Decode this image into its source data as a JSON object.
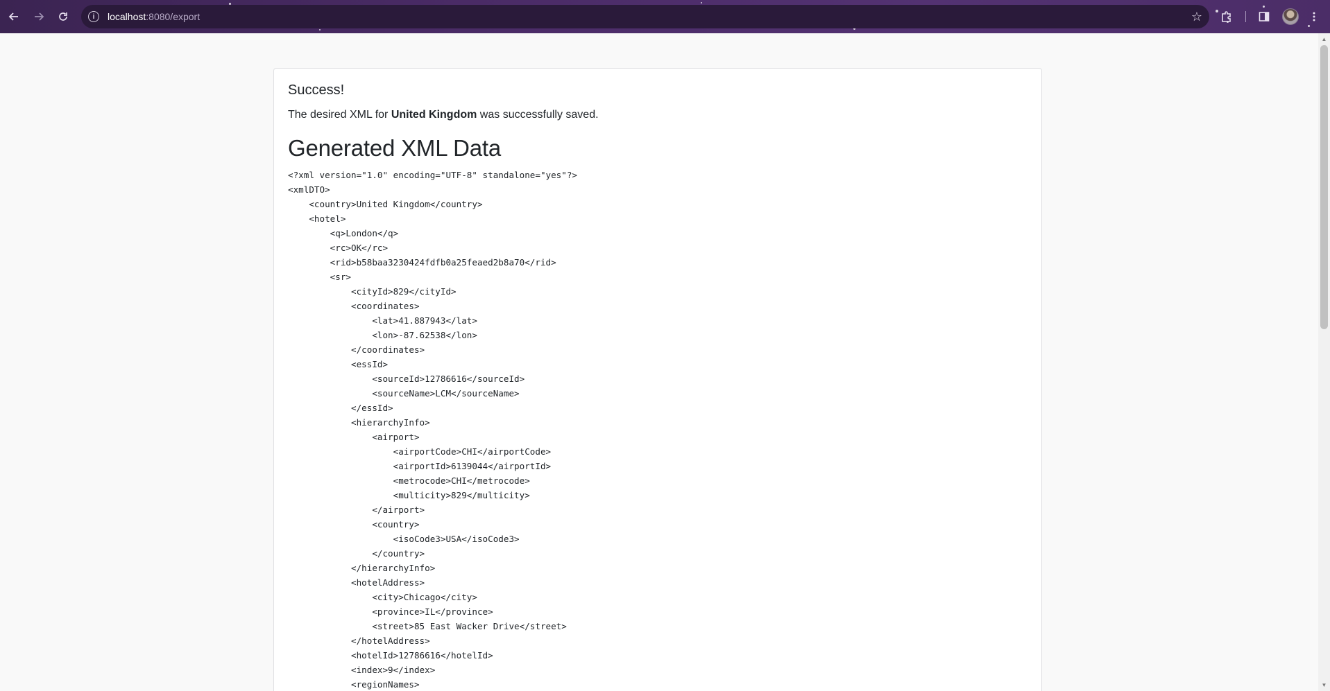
{
  "browser": {
    "url_host": "localhost",
    "url_path": ":8080/export"
  },
  "page": {
    "success_title": "Success!",
    "message_prefix": "The desired XML for ",
    "message_country": "United Kingdom",
    "message_suffix": " was successfully saved.",
    "section_title": "Generated XML Data",
    "xml_lines": [
      "<?xml version=\"1.0\" encoding=\"UTF-8\" standalone=\"yes\"?>",
      "<xmlDTO>",
      "    <country>United Kingdom</country>",
      "    <hotel>",
      "        <q>London</q>",
      "        <rc>OK</rc>",
      "        <rid>b58baa3230424fdfb0a25feaed2b8a70</rid>",
      "        <sr>",
      "            <cityId>829</cityId>",
      "            <coordinates>",
      "                <lat>41.887943</lat>",
      "                <lon>-87.62538</lon>",
      "            </coordinates>",
      "            <essId>",
      "                <sourceId>12786616</sourceId>",
      "                <sourceName>LCM</sourceName>",
      "            </essId>",
      "            <hierarchyInfo>",
      "                <airport>",
      "                    <airportCode>CHI</airportCode>",
      "                    <airportId>6139044</airportId>",
      "                    <metrocode>CHI</metrocode>",
      "                    <multicity>829</multicity>",
      "                </airport>",
      "                <country>",
      "                    <isoCode3>USA</isoCode3>",
      "                </country>",
      "            </hierarchyInfo>",
      "            <hotelAddress>",
      "                <city>Chicago</city>",
      "                <province>IL</province>",
      "                <street>85 East Wacker Drive</street>",
      "            </hotelAddress>",
      "            <hotelId>12786616</hotelId>",
      "            <index>9</index>",
      "            <regionNames>"
    ]
  }
}
